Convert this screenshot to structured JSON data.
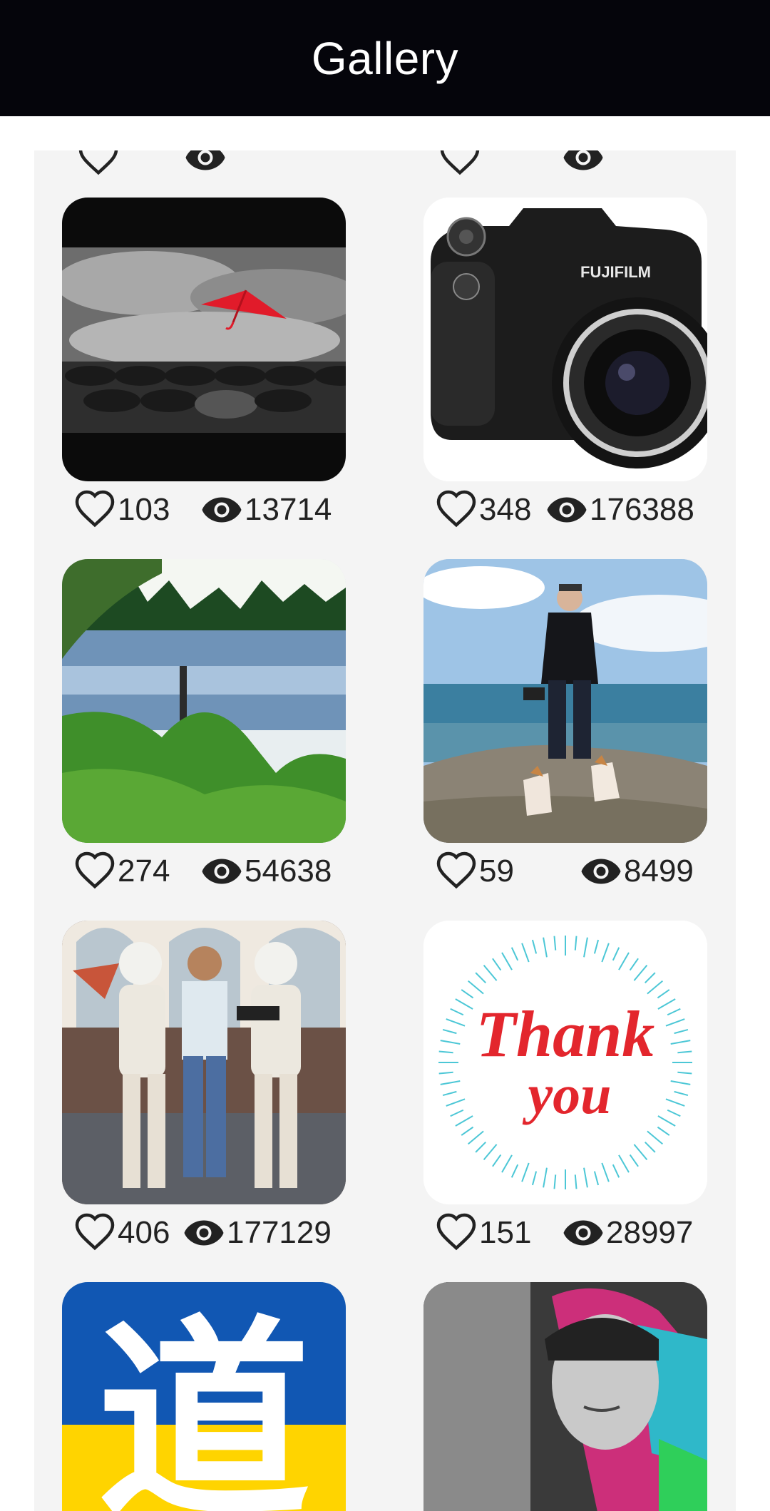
{
  "header": {
    "title": "Gallery"
  },
  "items": [
    {
      "likes": "103",
      "views": "13714",
      "image": "red umbrella among black umbrellas"
    },
    {
      "likes": "348",
      "views": "176388",
      "image": "Fujifilm camera"
    },
    {
      "likes": "274",
      "views": "54638",
      "image": "lake with reeds and forest"
    },
    {
      "likes": "59",
      "views": "8499",
      "image": "man with two dogs on cliff by sea"
    },
    {
      "likes": "406",
      "views": "177129",
      "image": "man between two stormtroopers"
    },
    {
      "likes": "151",
      "views": "28997",
      "image": "thank you card"
    },
    {
      "image": "chinese character on blue and yellow"
    },
    {
      "image": "portrait of woman with colorful hair"
    }
  ],
  "thank_you": {
    "line1": "Thank",
    "line2": "you"
  },
  "kanji": "道",
  "camera_brand": "FUJIFILM",
  "colors": {
    "header_bg": "#05050b",
    "panel_bg": "#f4f4f4",
    "text": "#222222"
  },
  "icons": {
    "like": "heart-outline-icon",
    "view": "eye-icon"
  }
}
